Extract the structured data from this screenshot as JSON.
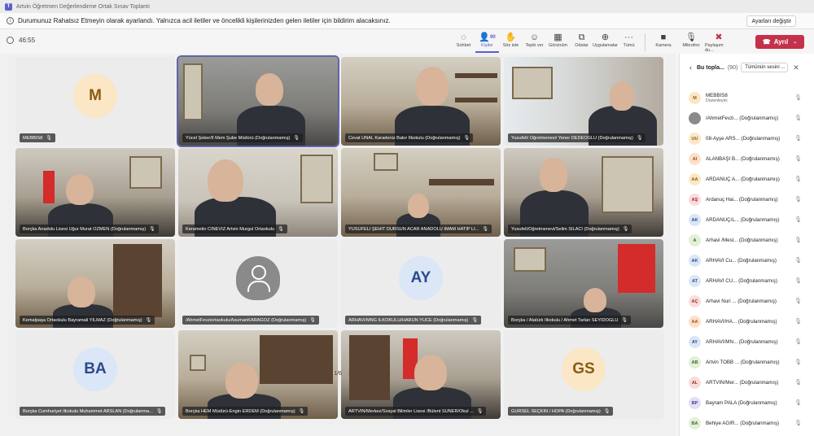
{
  "window": {
    "title": "Artvin Öğretmen Değerlendirme Ortak Sınav Toplantı",
    "app_badge": "T"
  },
  "banner": {
    "info_icon": "info-icon",
    "message": "Durumunuz Rahatsız Etmeyin olarak ayarlandı. Yalnızca acil iletiler ve öncelikli kişilerinizden gelen iletiler için bildirim alacaksınız.",
    "settings_label": "Ayarları değiştir"
  },
  "toolbar": {
    "timer": "46:55",
    "tools": [
      {
        "label": "Sohbet",
        "icon": "chat-icon",
        "glyph": "◌"
      },
      {
        "label": "Kişiler",
        "icon": "people-icon",
        "glyph": "👤",
        "count": "90"
      },
      {
        "label": "Söz iste",
        "icon": "raise-hand-icon",
        "glyph": "✋"
      },
      {
        "label": "Tepki ver",
        "icon": "emoji-icon",
        "glyph": "☺"
      },
      {
        "label": "Görünüm",
        "icon": "view-icon",
        "glyph": "▦"
      },
      {
        "label": "Odalar",
        "icon": "rooms-icon",
        "glyph": "⧉"
      },
      {
        "label": "Uygulamalar",
        "icon": "apps-icon",
        "glyph": "⊕"
      },
      {
        "label": "Tümü",
        "icon": "more-icon",
        "glyph": "···"
      }
    ],
    "media": [
      {
        "label": "Kamera",
        "icon": "camera-icon",
        "glyph": "■"
      },
      {
        "label": "Mikrofon",
        "icon": "microphone-icon",
        "glyph": "🎙"
      },
      {
        "label": "Paylaşım du...",
        "icon": "share-stop-icon",
        "glyph": "✖"
      }
    ],
    "leave_label": "Ayrıl",
    "leave_color": "#c4314b"
  },
  "tiles": [
    {
      "name": "MEBBİS8",
      "initials": "M",
      "avatar_bg": "#fbe7c6",
      "avatar_fg": "#8a5a14",
      "kind": "avatar"
    },
    {
      "name": "Yücel Şeker/İl Mem Şube Müdürü (Doğrulanmamış)",
      "kind": "video",
      "speaking": true
    },
    {
      "name": "Cevat ÜNAL Karadeniz Bakır İlkokulu (Doğrulanmamış)",
      "kind": "video"
    },
    {
      "name": "Yusufeli/ Öğretmenevi/ Yener DEDEOĞLU (Doğrulanmamış)",
      "kind": "video"
    },
    {
      "name": "Borçka Anadolu Lisesi Uğur Murat ÖZMEN (Doğrulanmamış)",
      "kind": "video"
    },
    {
      "name": "Kerametin CİNEVİZ Artvin Murgul Ortaokulu",
      "kind": "video"
    },
    {
      "name": "YUSUFELİ ŞEHİT DURSUN ACAR ANADOLU İMAM HATİP Lİ...",
      "kind": "video"
    },
    {
      "name": "Yusufeli/Öğretmenevi/Selim SILACI (Doğrulanmamış)",
      "kind": "video"
    },
    {
      "name": "Kemalpaşa Ortaokulu Bayramali YILMAZ (Doğrulanmamış)",
      "kind": "video"
    },
    {
      "name": "/AhmetFevziortaokulu/AsumanKARAGÖZ (Doğrulanmamış)",
      "kind": "person"
    },
    {
      "name": "ARHAVİ/MNG İLKOKULU/HARUN YÜCE (Doğrulanmamış)",
      "initials": "AY",
      "avatar_bg": "#dbe6f7",
      "avatar_fg": "#2c4a8a",
      "kind": "avatar"
    },
    {
      "name": "Borçka / Atatürk İlkokulu / Ahmet Tarlan SEYİDOĞLU",
      "kind": "video"
    },
    {
      "name": "Borçka Cumhuriyet İlkokulu Muhammet ARSLAN (Doğrulanma...",
      "initials": "BA",
      "avatar_bg": "#dbe6f7",
      "avatar_fg": "#2c4a8a",
      "kind": "avatar"
    },
    {
      "name": "Borçka HEM Müdürü-Engin ERDEM (Doğrulanmamış)",
      "kind": "video"
    },
    {
      "name": "ARTVİN/Merkez/Sosyal Bilimler Lisesi /Bülent SÜNER/Okul ...",
      "kind": "video"
    },
    {
      "name": "GÜRSEL SEÇKİN / HOPA (Doğrulanmamış)",
      "initials": "GS",
      "avatar_bg": "#fbe7c6",
      "avatar_fg": "#8a5a14",
      "kind": "avatar"
    }
  ],
  "pager": {
    "prev": "‹",
    "label": "1/6",
    "next": "›"
  },
  "panel": {
    "back": "‹",
    "title": "Bu topla...",
    "count": "(90)",
    "mute_all": "Tümünün sesini ...",
    "close": "✕",
    "participants": [
      {
        "initials": "M",
        "name": "MEBBİS8",
        "sub": "Düzenleyici",
        "bg": "#fbe7c6",
        "fg": "#8a5a14"
      },
      {
        "initials": "",
        "name": "/AhmetFevzi... (Doğrulanmamış)",
        "bg": "#8a8a8a",
        "fg": "#ffffff"
      },
      {
        "initials": "UU",
        "name": "08-Ayşe ARS... (Doğrulanmamış)",
        "bg": "#fbe7c6",
        "fg": "#8a5a14"
      },
      {
        "initials": "AI",
        "name": "ALANBAŞI B... (Doğrulanmamış)",
        "bg": "#fde0c8",
        "fg": "#a0521b"
      },
      {
        "initials": "AA",
        "name": "ARDANUÇ A... (Doğrulanmamış)",
        "bg": "#fbe7c6",
        "fg": "#8a5a14"
      },
      {
        "initials": "AŞ",
        "name": "Ardanuç Hai... (Doğrulanmamış)",
        "bg": "#f9dcdc",
        "fg": "#a12c2c"
      },
      {
        "initials": "AK",
        "name": "ARDANUÇ/L... (Doğrulanmamış)",
        "bg": "#dbe6f7",
        "fg": "#2c4a8a"
      },
      {
        "initials": "A",
        "name": "Arhavi /Mesl... (Doğrulanmamış)",
        "bg": "#e2efd9",
        "fg": "#3b6b2a"
      },
      {
        "initials": "AK",
        "name": "ARHAVİ Cu... (Doğrulanmamış)",
        "bg": "#dbe6f7",
        "fg": "#2c4a8a"
      },
      {
        "initials": "AT",
        "name": "ARHAVİ CU... (Doğrulanmamış)",
        "bg": "#dbe6f7",
        "fg": "#2c4a8a"
      },
      {
        "initials": "AÇ",
        "name": "Arhavi Nuri ... (Doğrulanmamış)",
        "bg": "#f9dcdc",
        "fg": "#a12c2c"
      },
      {
        "initials": "AA",
        "name": "ARHAVİ/HA... (Doğrulanmamış)",
        "bg": "#fde0c8",
        "fg": "#a0521b"
      },
      {
        "initials": "AY",
        "name": "ARHAVİ/MN... (Doğrulanmamış)",
        "bg": "#dbe6f7",
        "fg": "#2c4a8a"
      },
      {
        "initials": "AB",
        "name": "Artvin TOBB ... (Doğrulanmamış)",
        "bg": "#e2efd9",
        "fg": "#3b6b2a"
      },
      {
        "initials": "AL",
        "name": "ARTVİN/Mer... (Doğrulanmamış)",
        "bg": "#f9dcdc",
        "fg": "#a12c2c"
      },
      {
        "initials": "BP",
        "name": "Bayram PALA (Doğrulanmamış)",
        "bg": "#e3def5",
        "fg": "#4b3c8f"
      },
      {
        "initials": "BA",
        "name": "Behiye AĞIR... (Doğrulanmamış)",
        "bg": "#e2efd9",
        "fg": "#3b6b2a"
      }
    ]
  }
}
